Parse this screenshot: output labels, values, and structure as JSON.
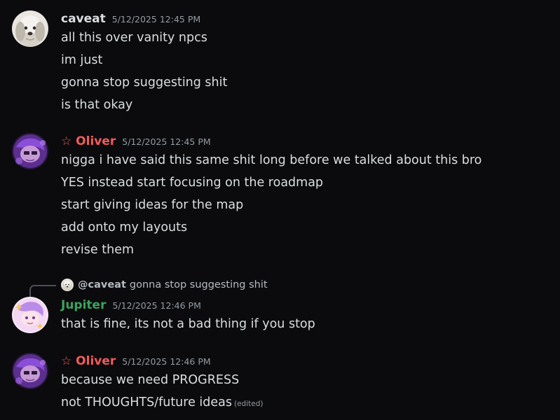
{
  "colors": {
    "background": "#0b0b0d",
    "text": "#dbdee1",
    "muted": "#949ba4",
    "oliver": "#f25b5b",
    "jupiter": "#3ba55d",
    "caveat": "#f2f3f5"
  },
  "messages": [
    {
      "author": "caveat",
      "timestamp": "5/12/2025 12:45 PM",
      "avatar_icon": "dog-avatar",
      "lines": [
        "all this over vanity npcs",
        "im just",
        "gonna stop suggesting shit",
        "is that okay"
      ]
    },
    {
      "author": "☆ Oliver",
      "timestamp": "5/12/2025 12:45 PM",
      "avatar_icon": "purple-art-avatar",
      "lines": [
        "nigga i have said this same shit long before we talked about this bro",
        "YES instead start focusing on the roadmap",
        "start giving ideas for the map",
        "add onto my layouts",
        "revise them"
      ]
    },
    {
      "author": "Jupiter",
      "timestamp": "5/12/2025 12:46 PM",
      "avatar_icon": "pink-art-avatar",
      "reply": {
        "mention": "@caveat",
        "text": "gonna stop suggesting shit"
      },
      "lines": [
        "that is fine, its not a bad thing if you stop"
      ]
    },
    {
      "author": "☆ Oliver",
      "timestamp": "5/12/2025 12:46 PM",
      "avatar_icon": "purple-art-avatar",
      "lines": [
        "because we need PROGRESS",
        "not THOUGHTS/future ideas"
      ],
      "edited_label": "(edited)"
    }
  ]
}
